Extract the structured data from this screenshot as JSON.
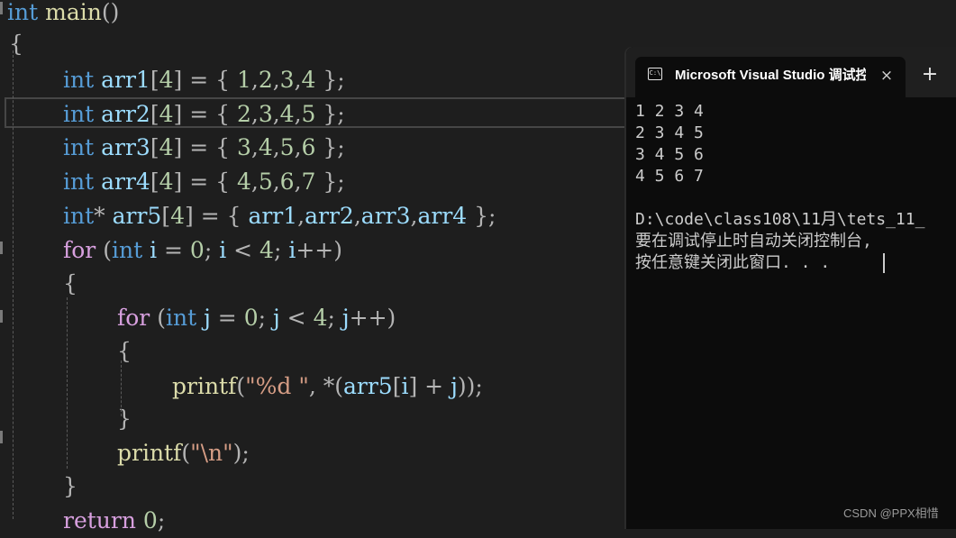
{
  "editor": {
    "lines": [
      [
        [
          "kw",
          "int"
        ],
        [
          "pun",
          " "
        ],
        [
          "fn",
          "main"
        ],
        [
          "pun",
          "()"
        ]
      ],
      [
        [
          "pun",
          "{"
        ]
      ],
      [
        [
          "kw",
          "int"
        ],
        [
          "pun",
          " "
        ],
        [
          "id",
          "arr1"
        ],
        [
          "pun",
          "["
        ],
        [
          "num",
          "4"
        ],
        [
          "pun",
          "] = { "
        ],
        [
          "num",
          "1"
        ],
        [
          "pun",
          ","
        ],
        [
          "num",
          "2"
        ],
        [
          "pun",
          ","
        ],
        [
          "num",
          "3"
        ],
        [
          "pun",
          ","
        ],
        [
          "num",
          "4"
        ],
        [
          "pun",
          " };"
        ]
      ],
      [
        [
          "kw",
          "int"
        ],
        [
          "pun",
          " "
        ],
        [
          "id",
          "arr2"
        ],
        [
          "pun",
          "["
        ],
        [
          "num",
          "4"
        ],
        [
          "pun",
          "] = { "
        ],
        [
          "num",
          "2"
        ],
        [
          "pun",
          ","
        ],
        [
          "num",
          "3"
        ],
        [
          "pun",
          ","
        ],
        [
          "num",
          "4"
        ],
        [
          "pun",
          ","
        ],
        [
          "num",
          "5"
        ],
        [
          "pun",
          " };"
        ]
      ],
      [
        [
          "kw",
          "int"
        ],
        [
          "pun",
          " "
        ],
        [
          "id",
          "arr3"
        ],
        [
          "pun",
          "["
        ],
        [
          "num",
          "4"
        ],
        [
          "pun",
          "] = { "
        ],
        [
          "num",
          "3"
        ],
        [
          "pun",
          ","
        ],
        [
          "num",
          "4"
        ],
        [
          "pun",
          ","
        ],
        [
          "num",
          "5"
        ],
        [
          "pun",
          ","
        ],
        [
          "num",
          "6"
        ],
        [
          "pun",
          " };"
        ]
      ],
      [
        [
          "kw",
          "int"
        ],
        [
          "pun",
          " "
        ],
        [
          "id",
          "arr4"
        ],
        [
          "pun",
          "["
        ],
        [
          "num",
          "4"
        ],
        [
          "pun",
          "] = { "
        ],
        [
          "num",
          "4"
        ],
        [
          "pun",
          ","
        ],
        [
          "num",
          "5"
        ],
        [
          "pun",
          ","
        ],
        [
          "num",
          "6"
        ],
        [
          "pun",
          ","
        ],
        [
          "num",
          "7"
        ],
        [
          "pun",
          " };"
        ]
      ],
      [
        [
          "kw",
          "int"
        ],
        [
          "pun",
          "* "
        ],
        [
          "id",
          "arr5"
        ],
        [
          "pun",
          "["
        ],
        [
          "num",
          "4"
        ],
        [
          "pun",
          "] = { "
        ],
        [
          "id",
          "arr1"
        ],
        [
          "pun",
          ","
        ],
        [
          "id",
          "arr2"
        ],
        [
          "pun",
          ","
        ],
        [
          "id",
          "arr3"
        ],
        [
          "pun",
          ","
        ],
        [
          "id",
          "arr4"
        ],
        [
          "pun",
          " };"
        ]
      ],
      [
        [
          "ctrl",
          "for"
        ],
        [
          "pun",
          " ("
        ],
        [
          "kw",
          "int"
        ],
        [
          "pun",
          " "
        ],
        [
          "id",
          "i"
        ],
        [
          "pun",
          " = "
        ],
        [
          "num",
          "0"
        ],
        [
          "pun",
          "; "
        ],
        [
          "id",
          "i"
        ],
        [
          "pun",
          " < "
        ],
        [
          "num",
          "4"
        ],
        [
          "pun",
          "; "
        ],
        [
          "id",
          "i"
        ],
        [
          "pun",
          "++)"
        ]
      ],
      [
        [
          "pun",
          "{"
        ]
      ],
      [
        [
          "ctrl",
          "for"
        ],
        [
          "pun",
          " ("
        ],
        [
          "kw",
          "int"
        ],
        [
          "pun",
          " "
        ],
        [
          "id",
          "j"
        ],
        [
          "pun",
          " = "
        ],
        [
          "num",
          "0"
        ],
        [
          "pun",
          "; "
        ],
        [
          "id",
          "j"
        ],
        [
          "pun",
          " < "
        ],
        [
          "num",
          "4"
        ],
        [
          "pun",
          "; "
        ],
        [
          "id",
          "j"
        ],
        [
          "pun",
          "++)"
        ]
      ],
      [
        [
          "pun",
          "{"
        ]
      ],
      [
        [
          "fn",
          "printf"
        ],
        [
          "pun",
          "("
        ],
        [
          "str",
          "\"%d \""
        ],
        [
          "pun",
          ", *("
        ],
        [
          "id",
          "arr5"
        ],
        [
          "pun",
          "["
        ],
        [
          "id",
          "i"
        ],
        [
          "pun",
          "] + "
        ],
        [
          "id",
          "j"
        ],
        [
          "pun",
          "));"
        ]
      ],
      [
        [
          "pun",
          "}"
        ]
      ],
      [
        [
          "fn",
          "printf"
        ],
        [
          "pun",
          "("
        ],
        [
          "str",
          "\"\\n\""
        ],
        [
          "pun",
          ");"
        ]
      ],
      [
        [
          "pun",
          "}"
        ]
      ],
      [
        [
          "ctrl",
          "return"
        ],
        [
          "pun",
          " "
        ],
        [
          "num",
          "0"
        ],
        [
          "pun",
          ";"
        ]
      ]
    ]
  },
  "terminal": {
    "tab_icon_text": "C:\\",
    "tab_title": "Microsoft Visual Studio 调试控",
    "close_label": "×",
    "new_tab_label": "+",
    "output_lines": [
      "1 2 3 4",
      "2 3 4 5",
      "3 4 5 6",
      "4 5 6 7",
      "",
      "D:\\code\\class108\\11月\\tets_11_",
      "要在调试停止时自动关闭控制台,",
      "按任意键关闭此窗口. . ."
    ]
  },
  "watermark": "CSDN @PPX相惜",
  "colors": {
    "editor_bg": "#1e1e1e",
    "terminal_bg": "#0c0c0c",
    "keyword": "#569cd6",
    "control": "#d8a0df",
    "identifier": "#9cdcfe",
    "function": "#dcdcaa",
    "number": "#b5cea8",
    "string": "#d69d85"
  }
}
